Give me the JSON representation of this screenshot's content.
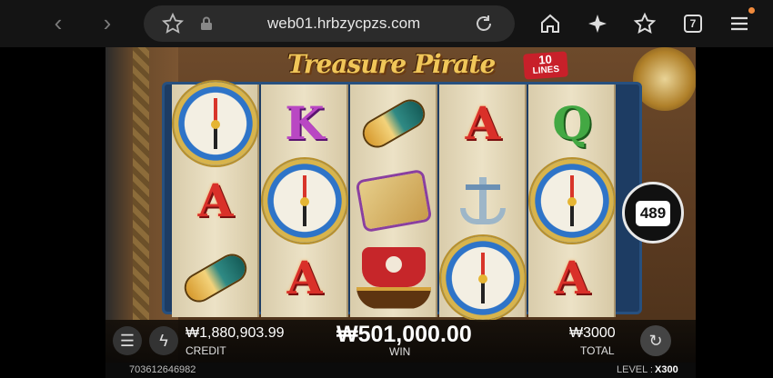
{
  "browser": {
    "url": "web01.hrbzycpzs.com",
    "tab_count": "7",
    "icons": [
      "back-icon",
      "forward-icon",
      "bookmark-star-icon",
      "lock-icon",
      "reload-icon",
      "home-icon",
      "sparkle-icon",
      "favorites-icon",
      "tabs-icon",
      "menu-icon"
    ]
  },
  "game": {
    "title": "Treasure Pirate",
    "lines_number": "10",
    "lines_label": "LINES",
    "counter": "489",
    "reels": [
      [
        "compass",
        "A",
        "spyglass"
      ],
      [
        "K",
        "compass",
        "A"
      ],
      [
        "spyglass",
        "map",
        "ship"
      ],
      [
        "A",
        "anchor",
        "compass"
      ],
      [
        "Q",
        "compass",
        "A"
      ]
    ]
  },
  "bottom": {
    "credit_value": "₩1,880,903.99",
    "credit_label": "CREDIT",
    "win_value": "₩501,000.00",
    "win_label": "WIN",
    "total_value": "₩3000",
    "total_label": "TOTAL",
    "session_id": "703612646982",
    "level_label": "LEVEL :",
    "level_value": "X300"
  }
}
